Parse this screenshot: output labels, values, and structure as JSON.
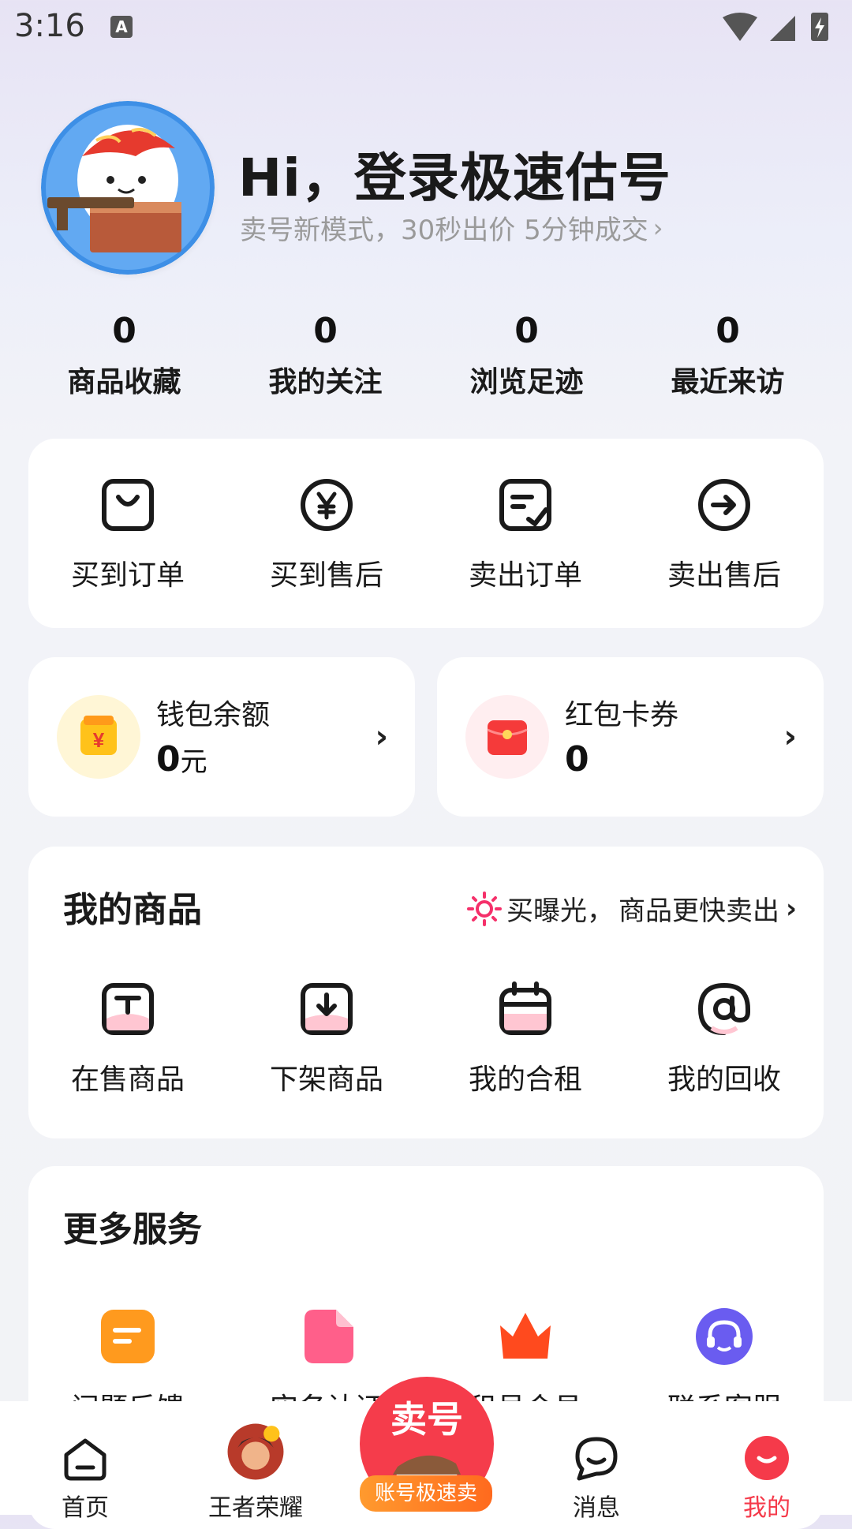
{
  "status_bar": {
    "time": "3:16",
    "a_icon": "A"
  },
  "profile": {
    "title": "Hi，登录极速估号",
    "subtitle": "卖号新模式，30秒出价 5分钟成交",
    "avatar_icon": "sushi-mascot-avatar"
  },
  "stats": [
    {
      "value": "0",
      "label": "商品收藏"
    },
    {
      "value": "0",
      "label": "我的关注"
    },
    {
      "value": "0",
      "label": "浏览足迹"
    },
    {
      "value": "0",
      "label": "最近来访"
    }
  ],
  "orders": [
    {
      "label": "买到订单",
      "icon": "bag-icon"
    },
    {
      "label": "买到售后",
      "icon": "yen-circle-icon"
    },
    {
      "label": "卖出订单",
      "icon": "note-check-icon"
    },
    {
      "label": "卖出售后",
      "icon": "arrow-right-circle-icon"
    }
  ],
  "wallet": {
    "title": "钱包余额",
    "value": "0",
    "unit": "元",
    "icon": "wallet-yen-icon"
  },
  "coupon": {
    "title": "红包卡券",
    "value": "0",
    "icon": "red-packet-icon"
  },
  "goods": {
    "title": "我的商品",
    "promo_a": "买曝光，",
    "promo_b": "商品更快卖出",
    "items": [
      {
        "label": "在售商品",
        "icon": "on-sale-icon"
      },
      {
        "label": "下架商品",
        "icon": "off-shelf-icon"
      },
      {
        "label": "我的合租",
        "icon": "calendar-icon"
      },
      {
        "label": "我的回收",
        "icon": "at-icon"
      }
    ]
  },
  "more": {
    "title": "更多服务",
    "items": [
      {
        "label": "问题反馈",
        "icon": "feedback-icon",
        "color": "#ff9a1e"
      },
      {
        "label": "实名认证",
        "icon": "id-card-icon",
        "color": "#ff5f8a"
      },
      {
        "label": "租号会员",
        "icon": "crown-icon",
        "color": "#ff4a1e"
      },
      {
        "label": "联系客服",
        "icon": "headset-icon",
        "color": "#6a5cf0"
      }
    ]
  },
  "tabbar": {
    "items": [
      {
        "label": "首页",
        "icon": "home-icon"
      },
      {
        "label": "王者荣耀",
        "icon": "game-avatar-icon"
      },
      {
        "label": "消息",
        "icon": "message-icon"
      },
      {
        "label": "我的",
        "icon": "profile-icon"
      }
    ],
    "sell_big": "卖号",
    "sell_tag": "账号极速卖",
    "active_color": "#f53a4a"
  }
}
